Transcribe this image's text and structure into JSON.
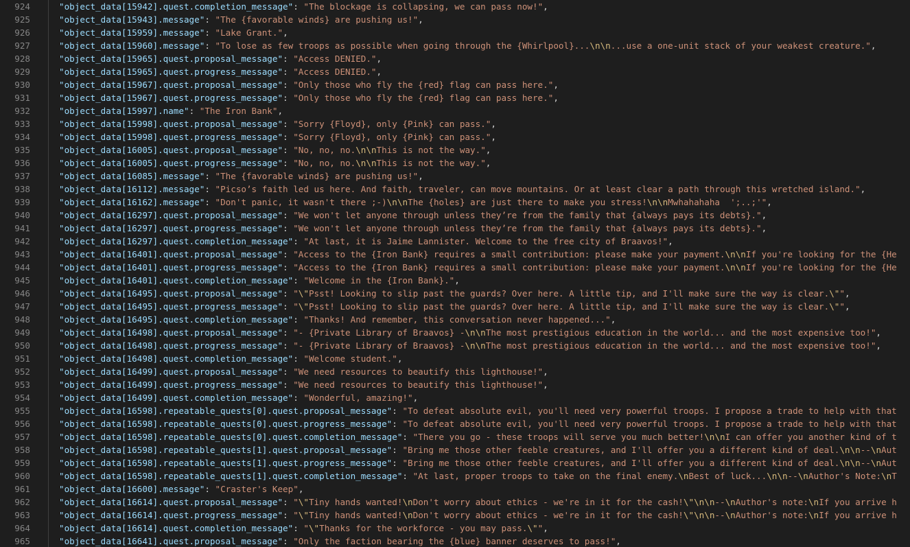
{
  "editor": {
    "colors": {
      "background": "#1e1e1e",
      "line_number": "#858585",
      "key": "#9cdcfe",
      "punctuation": "#d4d4d4",
      "string": "#ce9178",
      "escape": "#d7ba7d"
    },
    "lines": [
      {
        "num": "924",
        "key": "\"object_data[15942].quest.completion_message\"",
        "value": "\"The blockage is collapsing, we can pass now!\"",
        "end": ","
      },
      {
        "num": "925",
        "key": "\"object_data[15943].message\"",
        "value": "\"The {favorable winds} are pushing us!\"",
        "end": ","
      },
      {
        "num": "926",
        "key": "\"object_data[15959].message\"",
        "value": "\"Lake Grant.\"",
        "end": ","
      },
      {
        "num": "927",
        "key": "\"object_data[15960].message\"",
        "value": "\"To lose as few troops as possible when going through the {Whirlpool}...\\n\\n...use a one-unit stack of your weakest creature.\"",
        "end": ","
      },
      {
        "num": "928",
        "key": "\"object_data[15965].quest.proposal_message\"",
        "value": "\"Access DENIED.\"",
        "end": ","
      },
      {
        "num": "929",
        "key": "\"object_data[15965].quest.progress_message\"",
        "value": "\"Access DENIED.\"",
        "end": ","
      },
      {
        "num": "930",
        "key": "\"object_data[15967].quest.proposal_message\"",
        "value": "\"Only those who fly the {red} flag can pass here.\"",
        "end": ","
      },
      {
        "num": "931",
        "key": "\"object_data[15967].quest.progress_message\"",
        "value": "\"Only those who fly the {red} flag can pass here.\"",
        "end": ","
      },
      {
        "num": "932",
        "key": "\"object_data[15997].name\"",
        "value": "\"The Iron Bank\"",
        "end": ","
      },
      {
        "num": "933",
        "key": "\"object_data[15998].quest.proposal_message\"",
        "value": "\"Sorry {Floyd}, only {Pink} can pass.\"",
        "end": ","
      },
      {
        "num": "934",
        "key": "\"object_data[15998].quest.progress_message\"",
        "value": "\"Sorry {Floyd}, only {Pink} can pass.\"",
        "end": ","
      },
      {
        "num": "935",
        "key": "\"object_data[16005].quest.proposal_message\"",
        "value": "\"No, no, no.\\n\\nThis is not the way.\"",
        "end": ","
      },
      {
        "num": "936",
        "key": "\"object_data[16005].quest.progress_message\"",
        "value": "\"No, no, no.\\n\\nThis is not the way.\"",
        "end": ","
      },
      {
        "num": "937",
        "key": "\"object_data[16085].message\"",
        "value": "\"The {favorable winds} are pushing us!\"",
        "end": ","
      },
      {
        "num": "938",
        "key": "\"object_data[16112].message\"",
        "value": "\"Picso’s faith led us here. And faith, traveler, can move mountains. Or at least clear a path through this wretched island.\"",
        "end": ","
      },
      {
        "num": "939",
        "key": "\"object_data[16162].message\"",
        "value": "\"Don't panic, it wasn't there ;-)\\n\\nThe {holes} are just there to make you stress!\\n\\nMwhahahaha  ';..;'\"",
        "end": ","
      },
      {
        "num": "940",
        "key": "\"object_data[16297].quest.proposal_message\"",
        "value": "\"We won't let anyone through unless they’re from the family that {always pays its debts}.\"",
        "end": ","
      },
      {
        "num": "941",
        "key": "\"object_data[16297].quest.progress_message\"",
        "value": "\"We won't let anyone through unless they’re from the family that {always pays its debts}.\"",
        "end": ","
      },
      {
        "num": "942",
        "key": "\"object_data[16297].quest.completion_message\"",
        "value": "\"At last, it is Jaime Lannister. Welcome to the free city of Braavos!\"",
        "end": ","
      },
      {
        "num": "943",
        "key": "\"object_data[16401].quest.proposal_message\"",
        "value": "\"Access to the {Iron Bank} requires a small contribution: please make your payment.\\n\\nIf you're looking for the {He",
        "end": ""
      },
      {
        "num": "944",
        "key": "\"object_data[16401].quest.progress_message\"",
        "value": "\"Access to the {Iron Bank} requires a small contribution: please make your payment.\\n\\nIf you're looking for the {He",
        "end": ""
      },
      {
        "num": "945",
        "key": "\"object_data[16401].quest.completion_message\"",
        "value": "\"Welcome in the {Iron Bank}.\"",
        "end": ","
      },
      {
        "num": "946",
        "key": "\"object_data[16495].quest.proposal_message\"",
        "value": "\"\\\"Psst! Looking to slip past the guards? Over here. A little tip, and I'll make sure the way is clear.\\\"\"",
        "end": ","
      },
      {
        "num": "947",
        "key": "\"object_data[16495].quest.progress_message\"",
        "value": "\"\\\"Psst! Looking to slip past the guards? Over here. A little tip, and I'll make sure the way is clear.\\\"\"",
        "end": ","
      },
      {
        "num": "948",
        "key": "\"object_data[16495].quest.completion_message\"",
        "value": "\"Thanks! And remember, this conversation never happened...\"",
        "end": ","
      },
      {
        "num": "949",
        "key": "\"object_data[16498].quest.proposal_message\"",
        "value": "\"- {Private Library of Braavos} -\\n\\nThe most prestigious education in the world... and the most expensive too!\"",
        "end": ","
      },
      {
        "num": "950",
        "key": "\"object_data[16498].quest.progress_message\"",
        "value": "\"- {Private Library of Braavos} -\\n\\nThe most prestigious education in the world... and the most expensive too!\"",
        "end": ","
      },
      {
        "num": "951",
        "key": "\"object_data[16498].quest.completion_message\"",
        "value": "\"Welcome student.\"",
        "end": ","
      },
      {
        "num": "952",
        "key": "\"object_data[16499].quest.proposal_message\"",
        "value": "\"We need resources to beautify this lighthouse!\"",
        "end": ","
      },
      {
        "num": "953",
        "key": "\"object_data[16499].quest.progress_message\"",
        "value": "\"We need resources to beautify this lighthouse!\"",
        "end": ","
      },
      {
        "num": "954",
        "key": "\"object_data[16499].quest.completion_message\"",
        "value": "\"Wonderful, amazing!\"",
        "end": ","
      },
      {
        "num": "955",
        "key": "\"object_data[16598].repeatable_quests[0].quest.proposal_message\"",
        "value": "\"To defeat absolute evil, you'll need very powerful troops. I propose a trade to help with that",
        "end": ""
      },
      {
        "num": "956",
        "key": "\"object_data[16598].repeatable_quests[0].quest.progress_message\"",
        "value": "\"To defeat absolute evil, you'll need very powerful troops. I propose a trade to help with that",
        "end": ""
      },
      {
        "num": "957",
        "key": "\"object_data[16598].repeatable_quests[0].quest.completion_message\"",
        "value": "\"There you go - these troops will serve you much better!\\n\\nI can offer you another kind of t",
        "end": ""
      },
      {
        "num": "958",
        "key": "\"object_data[16598].repeatable_quests[1].quest.proposal_message\"",
        "value": "\"Bring me those other feeble creatures, and I'll offer you a different kind of deal.\\n\\n--\\nAut",
        "end": ""
      },
      {
        "num": "959",
        "key": "\"object_data[16598].repeatable_quests[1].quest.progress_message\"",
        "value": "\"Bring me those other feeble creatures, and I'll offer you a different kind of deal.\\n\\n--\\nAut",
        "end": ""
      },
      {
        "num": "960",
        "key": "\"object_data[16598].repeatable_quests[1].quest.completion_message\"",
        "value": "\"At last, proper troops to take on the final enemy.\\nBest of luck...\\n\\n--\\nAuthor's Note:\\nT",
        "end": ""
      },
      {
        "num": "961",
        "key": "\"object_data[16600].message\"",
        "value": "\"Craster's Keep\"",
        "end": ","
      },
      {
        "num": "962",
        "key": "\"object_data[16614].quest.proposal_message\"",
        "value": "\"\\\"Tiny hands wanted!\\nDon't worry about ethics - we're in it for the cash!\\\"\\n\\n--\\nAuthor's note:\\nIf you arrive h",
        "end": ""
      },
      {
        "num": "963",
        "key": "\"object_data[16614].quest.progress_message\"",
        "value": "\"\\\"Tiny hands wanted!\\nDon't worry about ethics - we're in it for the cash!\\\"\\n\\n--\\nAuthor's note:\\nIf you arrive h",
        "end": ""
      },
      {
        "num": "964",
        "key": "\"object_data[16614].quest.completion_message\"",
        "value": "\"\\\"Thanks for the workforce - you may pass.\\\"\"",
        "end": ","
      },
      {
        "num": "965",
        "key": "\"object_data[16641].quest.proposal_message\"",
        "value": "\"Only the faction bearing the {blue} banner deserves to pass!\"",
        "end": ","
      }
    ]
  }
}
